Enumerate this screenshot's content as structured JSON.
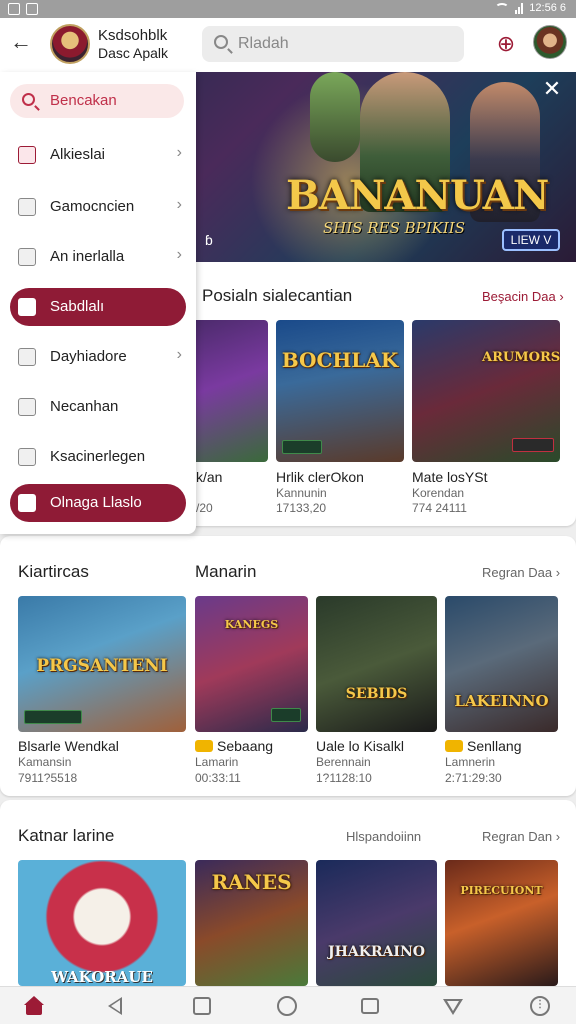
{
  "status_bar": {
    "time": "12:56 6"
  },
  "header": {
    "back_icon": "back-arrow-icon",
    "app_title": "Ksdsohblk",
    "app_subtitle": "Dasc Apalk",
    "search_placeholder": "Rladah",
    "gear_icon": "target-gear-icon"
  },
  "drawer": {
    "search_label": "Bencakan",
    "items": [
      {
        "label": "Alkieslai",
        "icon": "game-icon",
        "chevron": true,
        "active": false
      },
      {
        "label": "Gamocncien",
        "icon": "grid-icon",
        "chevron": true,
        "active": false
      },
      {
        "label": "An inerlalla",
        "icon": "list-icon",
        "chevron": true,
        "active": false
      },
      {
        "label": "Sabdlalı",
        "icon": "tag-icon",
        "chevron": false,
        "active": true
      },
      {
        "label": "Dayhiadore",
        "icon": "window-icon",
        "chevron": true,
        "active": false
      },
      {
        "label": "Necanhan",
        "icon": "settings-icon",
        "chevron": false,
        "active": false
      },
      {
        "label": "Ksacinerlegen",
        "icon": "file-icon",
        "chevron": false,
        "active": false
      },
      {
        "label": "Olnaga Llaslo",
        "icon": "pen-icon",
        "chevron": false,
        "active": true
      }
    ]
  },
  "banner": {
    "title": "BANANUAN",
    "subtitle": "SHIS RES BPIKIIS",
    "badge": "LIEW V",
    "corner_glyph": "ɓ"
  },
  "section1": {
    "title": "Posialn sialecantian",
    "link": "Beşacin Daa",
    "tiles": [
      {
        "name": "k/an",
        "sub": "",
        "num": "/20",
        "art": ""
      },
      {
        "name": "Hrlik clerOkon",
        "sub": "Kannunin",
        "num": "17133,20",
        "art": "BOCHLAK"
      },
      {
        "name": "Mate losYSt",
        "sub": "Korendan",
        "num": "774 24111",
        "art": "ARUMORS"
      }
    ]
  },
  "section2": {
    "title_left": "Kiartircas",
    "title_mid": "Manarin",
    "link": "Regran Daa",
    "tiles": [
      {
        "name": "Blsarle Wendkal",
        "sub": "Kamansin",
        "num": "7911?5518",
        "art": "PRGSANTENI",
        "coin": false
      },
      {
        "name": "Sebaang",
        "sub": "Lamarin",
        "num": "00:33:11",
        "art": "KANEGS",
        "coin": true
      },
      {
        "name": "Uale lo Kisalkl",
        "sub": "Berennain",
        "num": "1?1128:10",
        "art": "SEBIDS",
        "coin": false
      },
      {
        "name": "Senllang",
        "sub": "Lamnerin",
        "num": "2:71:29:30",
        "art": "LAKEINNO",
        "coin": true
      }
    ]
  },
  "section3": {
    "title": "Katnar larine",
    "mid": "Hlspandoiinn",
    "link": "Regran Dan",
    "tiles": [
      {
        "art": "WAKORAUE"
      },
      {
        "art": "RANES"
      },
      {
        "art": "JHAKRAINO"
      },
      {
        "art": "PIRECUIONT"
      }
    ]
  }
}
